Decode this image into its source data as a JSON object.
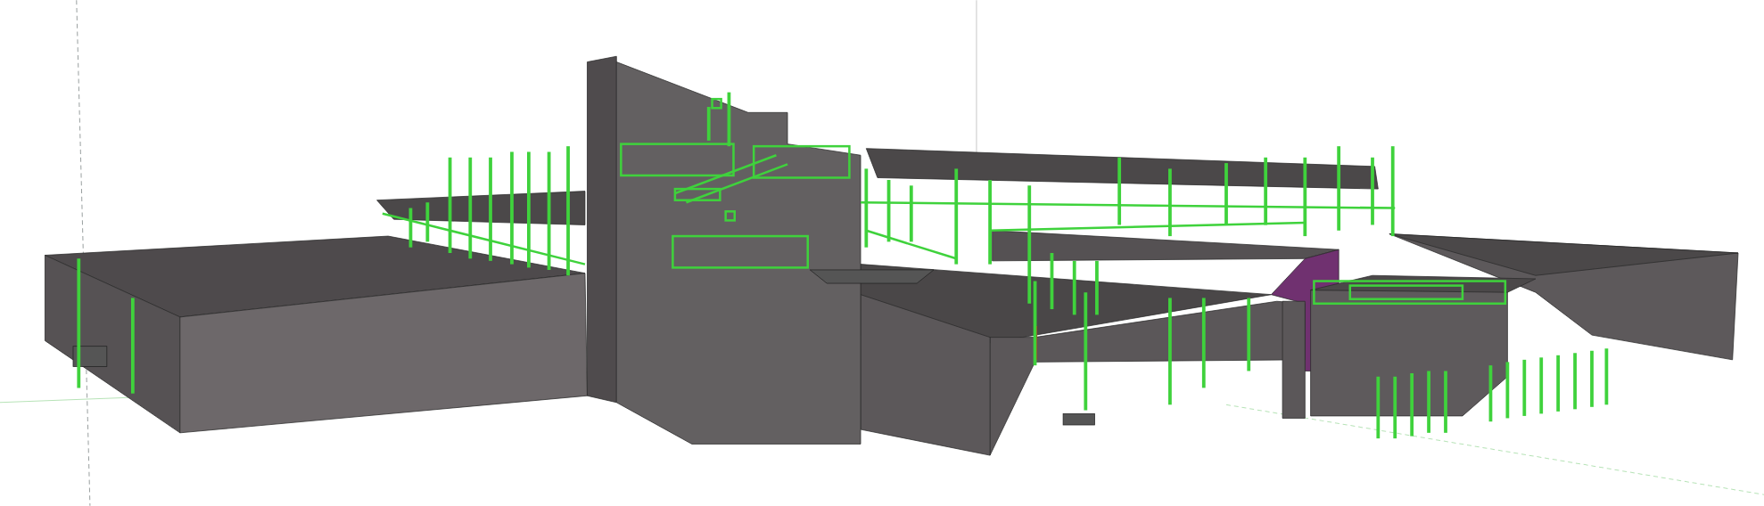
{
  "viewport": {
    "axes_visible": true
  }
}
